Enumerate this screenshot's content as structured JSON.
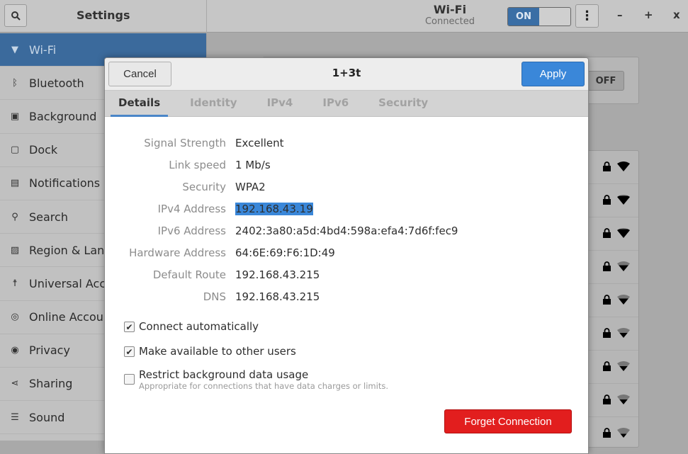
{
  "header": {
    "title": "Settings",
    "panel_title": "Wi-Fi",
    "panel_subtitle": "Connected",
    "wifi_switch": "ON",
    "minimize": "–",
    "maximize": "+",
    "close": "x"
  },
  "sidebar": {
    "items": [
      {
        "label": "Wi-Fi",
        "icon": "wifi-icon",
        "glyph": "▼",
        "active": true
      },
      {
        "label": "Bluetooth",
        "icon": "bluetooth-icon",
        "glyph": "ᛒ"
      },
      {
        "label": "Background",
        "icon": "background-icon",
        "glyph": "▣"
      },
      {
        "label": "Dock",
        "icon": "dock-icon",
        "glyph": "▢"
      },
      {
        "label": "Notifications",
        "icon": "notifications-icon",
        "glyph": "▤"
      },
      {
        "label": "Search",
        "icon": "search-icon",
        "glyph": "⚲"
      },
      {
        "label": "Region & Language",
        "icon": "region-icon",
        "glyph": "▨"
      },
      {
        "label": "Universal Access",
        "icon": "universal-access-icon",
        "glyph": "☨"
      },
      {
        "label": "Online Accounts",
        "icon": "online-accounts-icon",
        "glyph": "◎"
      },
      {
        "label": "Privacy",
        "icon": "privacy-icon",
        "glyph": "◉"
      },
      {
        "label": "Sharing",
        "icon": "sharing-icon",
        "glyph": "⋖"
      },
      {
        "label": "Sound",
        "icon": "sound-icon",
        "glyph": "☰"
      }
    ]
  },
  "airplane": {
    "toggle": "OFF"
  },
  "networks": [
    {
      "signal": 1.0
    },
    {
      "signal": 0.9
    },
    {
      "signal": 0.9
    },
    {
      "signal": 0.6
    },
    {
      "signal": 0.6
    },
    {
      "signal": 0.5
    },
    {
      "signal": 0.5
    },
    {
      "signal": 0.5
    },
    {
      "signal": 0.4
    }
  ],
  "dialog": {
    "title": "1+3t",
    "cancel": "Cancel",
    "apply": "Apply",
    "tabs": [
      "Details",
      "Identity",
      "IPv4",
      "IPv6",
      "Security"
    ],
    "details": [
      {
        "label": "Signal Strength",
        "value": "Excellent"
      },
      {
        "label": "Link speed",
        "value": "1 Mb/s"
      },
      {
        "label": "Security",
        "value": "WPA2"
      },
      {
        "label": "IPv4 Address",
        "value": "192.168.43.19"
      },
      {
        "label": "IPv6 Address",
        "value": "2402:3a80:a5d:4bd4:598a:efa4:7d6f:fec9"
      },
      {
        "label": "Hardware Address",
        "value": "64:6E:69:F6:1D:49"
      },
      {
        "label": "Default Route",
        "value": "192.168.43.215"
      },
      {
        "label": "DNS",
        "value": "192.168.43.215"
      }
    ],
    "connect_auto": {
      "label": "Connect automatically",
      "checked": true
    },
    "available_all": {
      "label": "Make available to other users",
      "checked": true
    },
    "restrict": {
      "label": "Restrict background data usage",
      "hint": "Appropriate for connections that have data charges or limits.",
      "checked": false
    },
    "forget": "Forget Connection"
  },
  "colors": {
    "accent": "#3a87d9",
    "destructive": "#e21e1e",
    "sidebar_active": "#3b6a9c"
  }
}
